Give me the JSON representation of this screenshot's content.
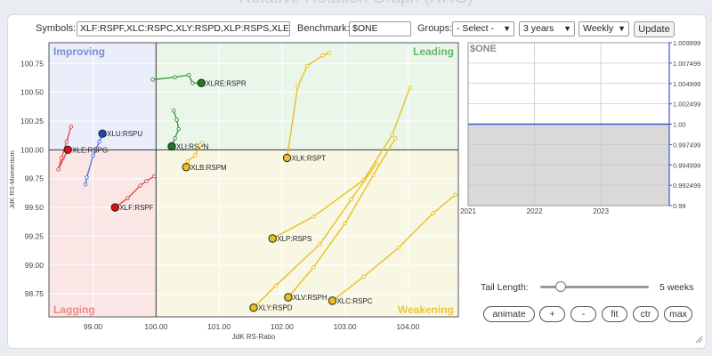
{
  "page_title": "Relative Rotation Graph (RRG)",
  "controls": {
    "symbols_label": "Symbols:",
    "symbols_value": "XLF:RSPF,XLC:RSPC,XLY:RSPD,XLP:RSPS,XLE:",
    "benchmark_label": "Benchmark:",
    "benchmark_value": "$ONE",
    "groups_label": "Groups:",
    "groups_selected": "- Select -",
    "period_selected": "3 years",
    "frequency_selected": "Weekly",
    "update_label": "Update"
  },
  "rrg": {
    "quadrants": {
      "improving": "Improving",
      "leading": "Leading",
      "lagging": "Lagging",
      "weakening": "Weakening"
    },
    "colors": {
      "improving": "#eaedfa",
      "leading": "#eaf6ea",
      "lagging": "#fbe6e6",
      "weakening": "#f8f7e3",
      "improving_text": "#7d8fcf",
      "leading_text": "#6ab56a",
      "lagging_text": "#ef8a8a",
      "weakening_text": "#e8c83a"
    },
    "xlabel": "JdK RS-Ratio",
    "ylabel": "JdK RS-Momentum",
    "xlim": [
      98.3,
      104.8
    ],
    "ylim": [
      98.55,
      100.93
    ],
    "x_ticks": [
      "99.00",
      "100.00",
      "101.00",
      "102.00",
      "103.00",
      "104.00"
    ],
    "x_tick_values": [
      99,
      100,
      101,
      102,
      103,
      104
    ],
    "y_ticks": [
      "100.75",
      "100.50",
      "100.25",
      "100.00",
      "99.75",
      "99.50",
      "99.25",
      "99.00",
      "98.75"
    ],
    "y_tick_values": [
      100.75,
      100.5,
      100.25,
      100.0,
      99.75,
      99.5,
      99.25,
      99.0,
      98.75
    ],
    "series": [
      {
        "name": "XLRE:RSPR",
        "color": "#3a9a3a",
        "head": "#1f7a1f",
        "tail": [
          [
            99.95,
            100.61
          ],
          [
            100.3,
            100.63
          ],
          [
            100.52,
            100.65
          ],
          [
            100.58,
            100.58
          ],
          [
            100.72,
            100.58
          ]
        ]
      },
      {
        "name": "XLI:RSPN",
        "color": "#3a9a3a",
        "head": "#1f7a1f",
        "tail": [
          [
            100.28,
            100.34
          ],
          [
            100.33,
            100.26
          ],
          [
            100.36,
            100.18
          ],
          [
            100.3,
            100.1
          ],
          [
            100.25,
            100.03
          ]
        ]
      },
      {
        "name": "XLU:RSPU",
        "color": "#5577dd",
        "head": "#2244bb",
        "tail": [
          [
            98.88,
            99.7
          ],
          [
            98.9,
            99.76
          ],
          [
            99.0,
            99.95
          ],
          [
            99.1,
            100.07
          ],
          [
            99.15,
            100.14
          ]
        ]
      },
      {
        "name": "XLE:RSPG",
        "color": "#e14a4a",
        "head": "#dd1111",
        "tail": [
          [
            98.65,
            100.2
          ],
          [
            98.58,
            100.07
          ],
          [
            98.5,
            99.93
          ],
          [
            98.45,
            99.83
          ],
          [
            98.6,
            100.0
          ]
        ]
      },
      {
        "name": "XLF:RSPF",
        "color": "#e14a4a",
        "head": "#dd1111",
        "tail": [
          [
            99.97,
            99.77
          ],
          [
            99.85,
            99.73
          ],
          [
            99.75,
            99.69
          ],
          [
            99.55,
            99.58
          ],
          [
            99.35,
            99.5
          ]
        ]
      },
      {
        "name": "XLB:RSPM",
        "color": "#e8c020",
        "head": "#e8c020",
        "tail": [
          [
            100.73,
            100.06
          ],
          [
            100.7,
            100.04
          ],
          [
            100.62,
            99.95
          ],
          [
            100.5,
            99.9
          ],
          [
            100.48,
            99.85
          ]
        ]
      },
      {
        "name": "XLK:RSPT",
        "color": "#e8c020",
        "head": "#e8c020",
        "tail": [
          [
            102.75,
            100.84
          ],
          [
            102.65,
            100.82
          ],
          [
            102.4,
            100.73
          ],
          [
            102.25,
            100.55
          ],
          [
            102.08,
            99.93
          ]
        ]
      },
      {
        "name": "XLP:RSPS",
        "color": "#e8c020",
        "head": "#e8c020",
        "tail": [
          [
            104.03,
            100.54
          ],
          [
            103.75,
            100.13
          ],
          [
            103.3,
            99.74
          ],
          [
            102.5,
            99.42
          ],
          [
            101.85,
            99.23
          ]
        ]
      },
      {
        "name": "XLY:RSPD",
        "color": "#e8c020",
        "head": "#e8c020",
        "tail": [
          [
            103.5,
            99.88
          ],
          [
            103.1,
            99.57
          ],
          [
            102.6,
            99.18
          ],
          [
            101.9,
            98.82
          ],
          [
            101.55,
            98.63
          ]
        ]
      },
      {
        "name": "XLV:RSPH",
        "color": "#e8c020",
        "head": "#e8c020",
        "tail": [
          [
            103.8,
            100.1
          ],
          [
            103.45,
            99.78
          ],
          [
            103.0,
            99.36
          ],
          [
            102.5,
            98.98
          ],
          [
            102.1,
            98.72
          ]
        ]
      },
      {
        "name": "XLC:RSPC",
        "color": "#e8c020",
        "head": "#e8c020",
        "tail": [
          [
            104.75,
            99.61
          ],
          [
            104.4,
            99.45
          ],
          [
            103.85,
            99.15
          ],
          [
            103.3,
            98.9
          ],
          [
            102.8,
            98.69
          ]
        ]
      }
    ]
  },
  "benchmark_chart": {
    "title": "$ONE",
    "y_ticks": [
      "1.009999",
      "1.007499",
      "1.004999",
      "1.002499",
      "1.00",
      "0.997499",
      "0.994999",
      "0.992499",
      "0.99"
    ],
    "x_ticks": [
      "2021",
      "2022",
      "2023"
    ],
    "ylim": [
      0.99,
      1.01
    ],
    "value": 1.0,
    "line_color": "#4455cc",
    "fill_color": "#d9d9d9"
  },
  "tail_control": {
    "label": "Tail Length:",
    "value_text": "5 weeks",
    "value": 5,
    "max": 26
  },
  "buttons": {
    "animate": "animate",
    "plus": "+",
    "minus": "-",
    "fit": "fit",
    "ctr": "ctr",
    "max": "max"
  }
}
